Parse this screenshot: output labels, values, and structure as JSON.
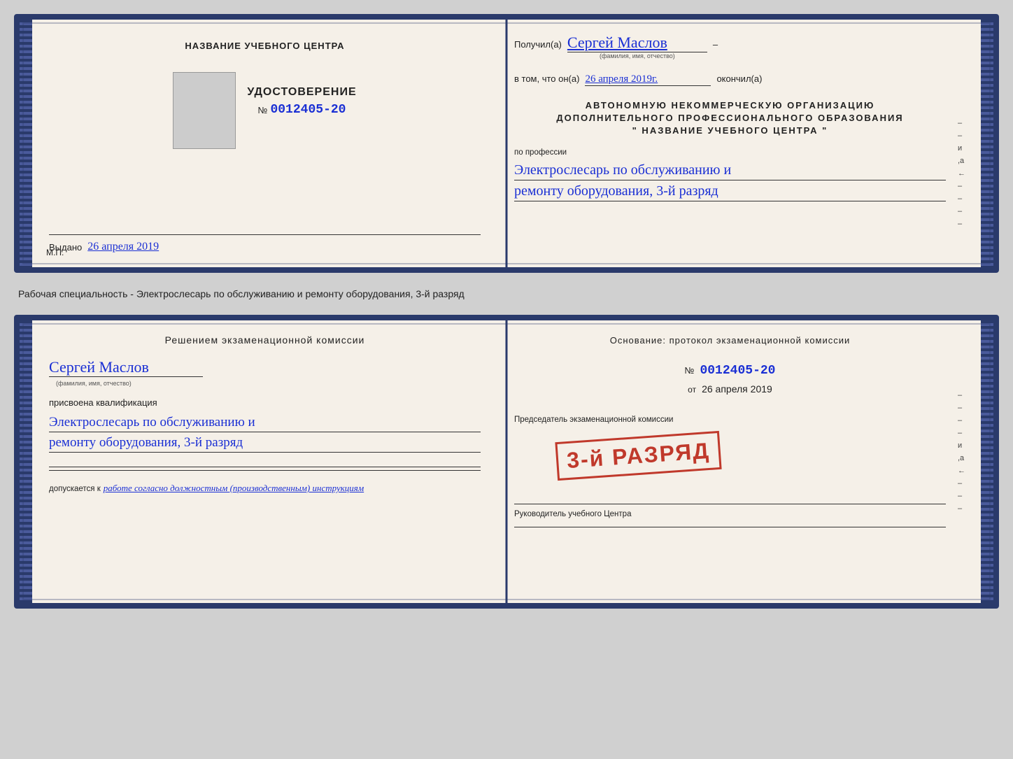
{
  "card1": {
    "left": {
      "org_name_label": "НАЗВАНИЕ УЧЕБНОГО ЦЕНТРА",
      "cert_label": "УДОСТОВЕРЕНИЕ",
      "cert_number_prefix": "№",
      "cert_number": "0012405-20",
      "issued_label": "Выдано",
      "issued_date": "26 апреля 2019",
      "mp_label": "М.П."
    },
    "right": {
      "received_label": "Получил(а)",
      "recipient_name": "Сергей Маслов",
      "fio_label": "(фамилия, имя, отчество)",
      "dash": "–",
      "in_that_label": "в том, что он(а)",
      "completed_date": "26 апреля 2019г.",
      "completed_label": "окончил(а)",
      "org_line1": "АВТОНОМНУЮ НЕКОММЕРЧЕСКУЮ ОРГАНИЗАЦИЮ",
      "org_line2": "ДОПОЛНИТЕЛЬНОГО ПРОФЕССИОНАЛЬНОГО ОБРАЗОВАНИЯ",
      "org_name_quoted": "\"  НАЗВАНИЕ УЧЕБНОГО ЦЕНТРА  \"",
      "profession_label": "по профессии",
      "profession_handwritten_line1": "Электрослесарь по обслуживанию и",
      "profession_handwritten_line2": "ремонту оборудования, 3-й разряд",
      "right_letters": [
        "–",
        "–",
        "и",
        ",а",
        "←",
        "–",
        "–",
        "–",
        "–"
      ]
    }
  },
  "between_cards_text": "Рабочая специальность - Электрослесарь по обслуживанию и ремонту оборудования, 3-й разряд",
  "card2": {
    "left": {
      "decision_label": "Решением экзаменационной комиссии",
      "person_name": "Сергей Маслов",
      "fio_label": "(фамилия, имя, отчество)",
      "assigned_label": "присвоена квалификация",
      "qualification_line1": "Электрослесарь по обслуживанию и",
      "qualification_line2": "ремонту оборудования, 3-й разряд",
      "allowed_label": "допускается к",
      "allowed_value": "работе согласно должностным (производственным) инструкциям"
    },
    "right": {
      "basis_label": "Основание: протокол экзаменационной комиссии",
      "number_prefix": "№",
      "number": "0012405-20",
      "date_prefix": "от",
      "date": "26 апреля 2019",
      "chairman_label": "Председатель экзаменационной комиссии",
      "director_label": "Руководитель учебного Центра",
      "stamp_line1": "3-й разряд",
      "stamp_big": "3-й РАЗРЯД",
      "right_letters": [
        "–",
        "–",
        "–",
        "–",
        "и",
        ",а",
        "←",
        "–",
        "–",
        "–"
      ]
    }
  }
}
